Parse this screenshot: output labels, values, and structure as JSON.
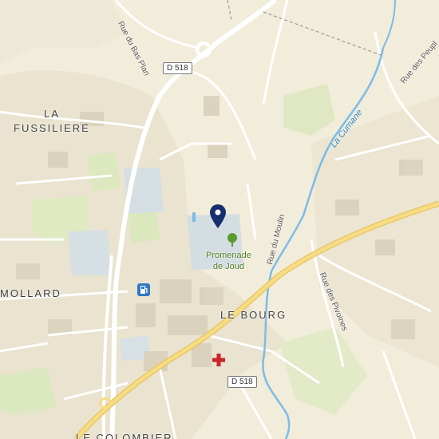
{
  "places": {
    "la_fussiliere": [
      "LA",
      "FUSSILIERE"
    ],
    "mollard": "MOLLARD",
    "le_bourg": "LE BOURG",
    "le_colombier": "LE COLOMBIER"
  },
  "streets": {
    "bas_plan": "Rue du Bas Plan",
    "moulin": "Rue du Moulin",
    "pivoines": "Rue des Pivoines",
    "peupliers": "Rue des Peupl"
  },
  "river": "La Cumane",
  "road_shields": {
    "north": "D 518",
    "south": "D 518"
  },
  "poi": {
    "park_line1": "Promenade",
    "park_line2": "de Joud"
  },
  "icons": [
    "map-pin-icon",
    "tree-icon",
    "fuel-station-icon",
    "hospital-cross-icon"
  ],
  "colors": {
    "background": "#f2ecda",
    "built_area": "#e8e1cc",
    "green": "#dfe8c2",
    "water": "#7bbce8",
    "main_road": "#f5d67a",
    "pin": "#15306e",
    "hospital": "#c8262a",
    "fuel": "#2f78c4"
  }
}
